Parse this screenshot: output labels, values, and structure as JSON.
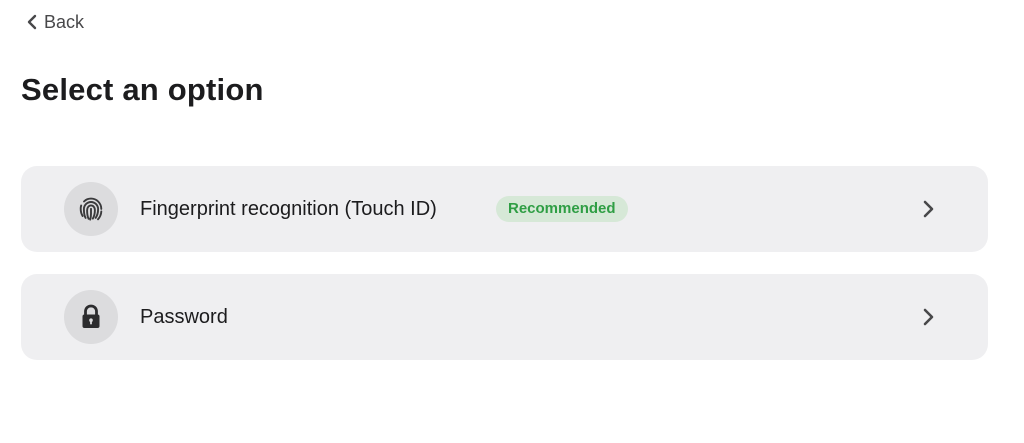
{
  "header": {
    "back_label": "Back",
    "title": "Select an option"
  },
  "options": [
    {
      "label": "Fingerprint recognition (Touch ID)",
      "badge": "Recommended",
      "icon": "fingerprint-icon"
    },
    {
      "label": "Password",
      "icon": "lock-icon"
    }
  ],
  "colors": {
    "card_background": "#efeff1",
    "icon_circle": "#dcdcde",
    "badge_background": "#d6e8d7",
    "badge_text": "#2f9e44"
  }
}
